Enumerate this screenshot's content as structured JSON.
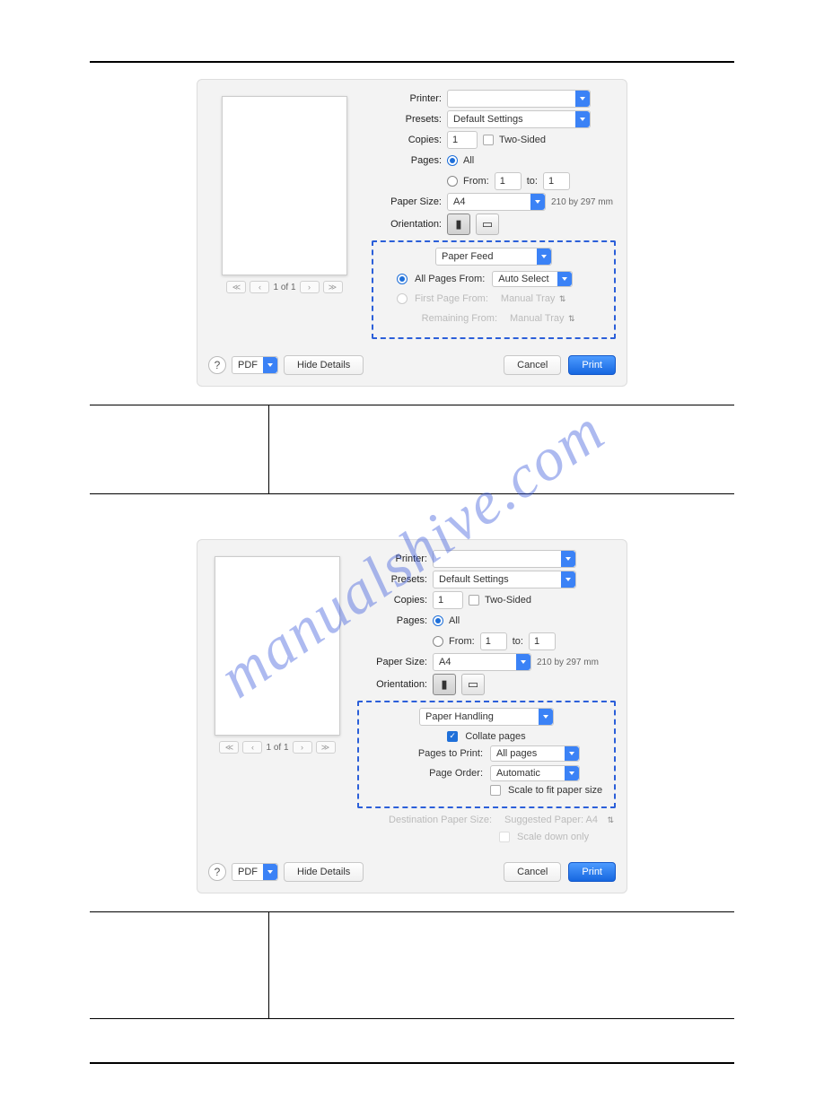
{
  "watermark": "manualshive.com",
  "dialog1": {
    "labels": {
      "printer": "Printer:",
      "presets": "Presets:",
      "copies": "Copies:",
      "pages": "Pages:",
      "paper_size": "Paper Size:",
      "orientation": "Orientation:",
      "two_sided": "Two-Sided",
      "all": "All",
      "from": "From:",
      "to": "to:"
    },
    "presets_value": "Default Settings",
    "copies_value": "1",
    "from_value": "1",
    "to_value": "1",
    "paper_size_value": "A4",
    "paper_dims": "210 by 297 mm",
    "pager": "1 of 1",
    "section_select": "Paper Feed",
    "feed": {
      "all_pages_from": "All Pages From:",
      "first_page_from": "First Page From:",
      "remaining_from": "Remaining From:",
      "auto_select": "Auto Select",
      "manual_tray": "Manual Tray"
    },
    "buttons": {
      "help": "?",
      "pdf": "PDF",
      "hide_details": "Hide Details",
      "cancel": "Cancel",
      "print": "Print"
    }
  },
  "dialog2": {
    "labels": {
      "printer": "Printer:",
      "presets": "Presets:",
      "copies": "Copies:",
      "pages": "Pages:",
      "paper_size": "Paper Size:",
      "orientation": "Orientation:",
      "two_sided": "Two-Sided",
      "all": "All",
      "from": "From:",
      "to": "to:"
    },
    "presets_value": "Default Settings",
    "copies_value": "1",
    "from_value": "1",
    "to_value": "1",
    "paper_size_value": "A4",
    "paper_dims": "210 by 297 mm",
    "pager": "1 of 1",
    "section_select": "Paper Handling",
    "handling": {
      "collate": "Collate pages",
      "pages_to_print": "Pages to Print:",
      "pages_to_print_value": "All pages",
      "page_order": "Page Order:",
      "page_order_value": "Automatic",
      "scale_to_fit": "Scale to fit paper size",
      "dest_paper_size": "Destination Paper Size:",
      "suggested": "Suggested Paper: A4",
      "scale_down": "Scale down only"
    },
    "buttons": {
      "help": "?",
      "pdf": "PDF",
      "hide_details": "Hide Details",
      "cancel": "Cancel",
      "print": "Print"
    }
  }
}
